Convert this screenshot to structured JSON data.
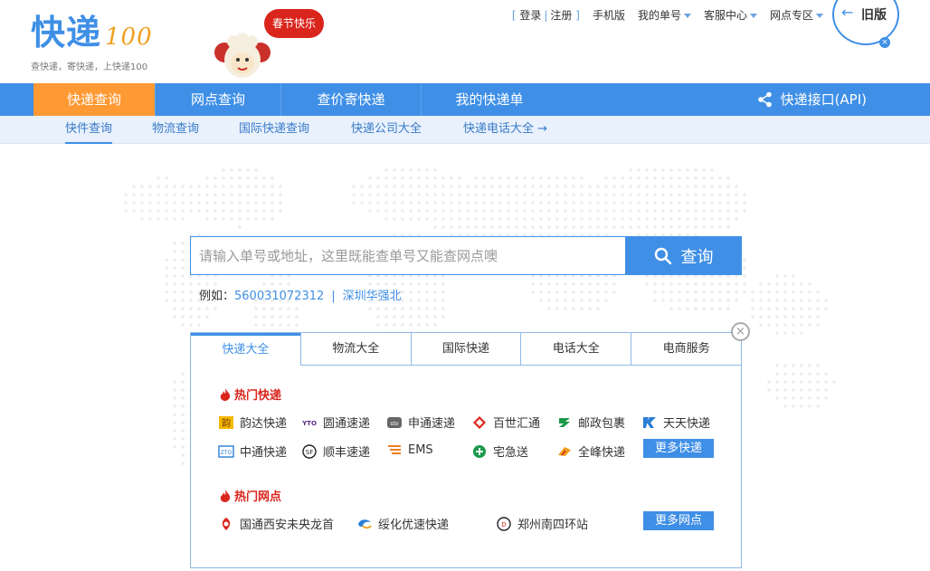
{
  "header": {
    "logo_text": "快递",
    "logo_100": "100",
    "logo_slogan": "查快递，寄快递，上快递100",
    "bubble": "春节快乐",
    "topnav": {
      "login": "登录",
      "sep": "|",
      "register": "注册",
      "mobile": "手机版",
      "my_orders": "我的单号",
      "service": "客服中心",
      "outlets": "网点专区"
    },
    "old_version": "旧版"
  },
  "mainnav": {
    "items": [
      "快递查询",
      "网点查询",
      "查价寄快递",
      "我的快递单"
    ],
    "api": "快递接口(API)"
  },
  "subnav": {
    "items": [
      "快件查询",
      "物流查询",
      "国际快递查询",
      "快递公司大全",
      "快递电话大全"
    ]
  },
  "search": {
    "placeholder": "请输入单号或地址，这里既能查单号又能查网点噢",
    "button": "查询",
    "example_label": "例如：",
    "example_number": "560031072312",
    "example_sep": "|",
    "example_place": "深圳华强北"
  },
  "panel": {
    "tabs": [
      "快递大全",
      "物流大全",
      "国际快递",
      "电话大全",
      "电商服务"
    ],
    "hot_express_title": "热门快递",
    "express": [
      "韵达快递",
      "圆通速递",
      "申通速递",
      "百世汇通",
      "邮政包裹",
      "天天快递",
      "中通快递",
      "顺丰速递",
      "EMS",
      "宅急送",
      "全峰快递"
    ],
    "more_express": "更多快递",
    "hot_outlets_title": "热门网点",
    "outlets": [
      "国通西安未央龙首",
      "绥化优速快递",
      "郑州南四环站"
    ],
    "more_outlets": "更多网点"
  },
  "colors": {
    "brand_blue": "#3f8fe6",
    "active_orange": "#ff9933",
    "hot_red": "#d9251c"
  }
}
